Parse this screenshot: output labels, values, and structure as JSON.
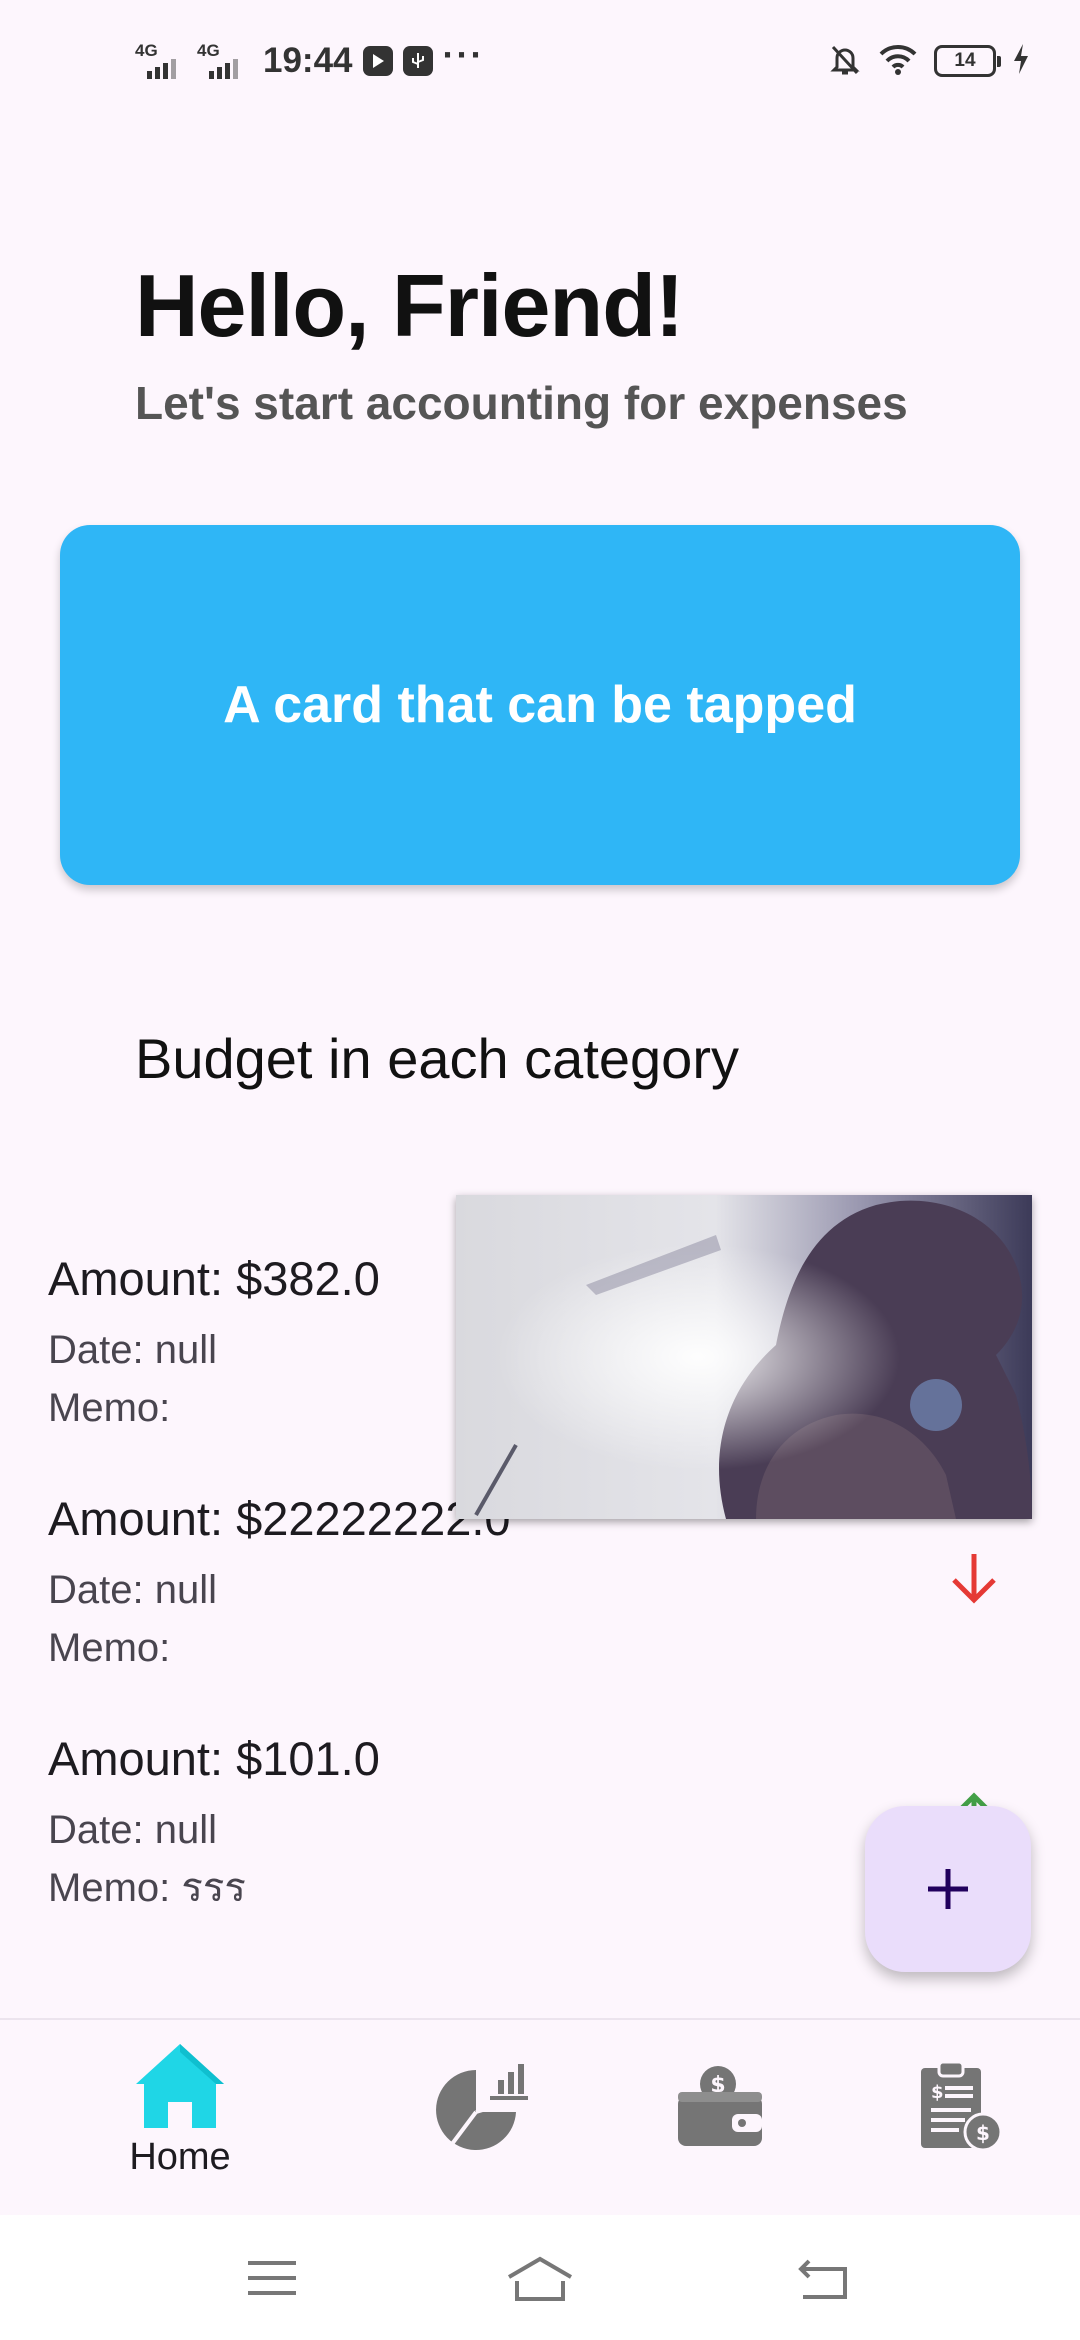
{
  "status_bar": {
    "network_1": "4G",
    "network_2": "4G",
    "time": "19:44",
    "more": "···",
    "battery": "14"
  },
  "header": {
    "greeting": "Hello, Friend!",
    "subtitle": "Let's start accounting for expenses"
  },
  "card": {
    "label": "A card that can be tapped",
    "color": "#2fb6f6"
  },
  "section": {
    "title": "Budget in each category"
  },
  "expenses": [
    {
      "amount": "Amount: $382.0",
      "date": "Date: null",
      "memo": "Memo:",
      "trend": "none"
    },
    {
      "amount": "Amount: $22222222.0",
      "date": "Date: null",
      "memo": "Memo:",
      "trend": "down",
      "trend_color": "#e53935"
    },
    {
      "amount": "Amount: $101.0",
      "date": "Date: null",
      "memo": "Memo: รรร",
      "trend": "up",
      "trend_color": "#43a047"
    }
  ],
  "fab": {
    "icon": "plus-icon",
    "color": "#eaddfb"
  },
  "bottom_nav": {
    "items": [
      {
        "label": "Home",
        "icon": "home-icon",
        "active": true,
        "color": "#1fd6e6"
      },
      {
        "label": "",
        "icon": "pie-chart-icon",
        "active": false
      },
      {
        "label": "",
        "icon": "wallet-icon",
        "active": false
      },
      {
        "label": "",
        "icon": "invoice-icon",
        "active": false
      }
    ]
  },
  "system_nav": {
    "items": [
      "menu-icon",
      "home-outline-icon",
      "back-icon"
    ]
  }
}
